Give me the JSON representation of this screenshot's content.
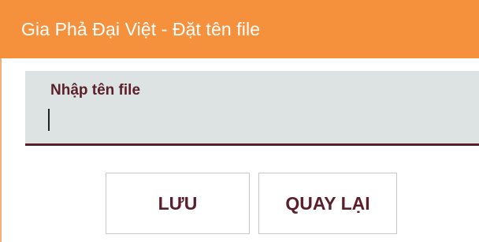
{
  "window": {
    "title": "Gia Phả Đại Việt - Đặt tên file"
  },
  "form": {
    "label": "Nhập tên file",
    "value": ""
  },
  "buttons": {
    "save_label": "LƯU",
    "back_label": "QUAY LẠI"
  },
  "colors": {
    "title_bar": "#f5913c",
    "input_background": "#dde3e3",
    "accent": "#5a1f2a"
  }
}
